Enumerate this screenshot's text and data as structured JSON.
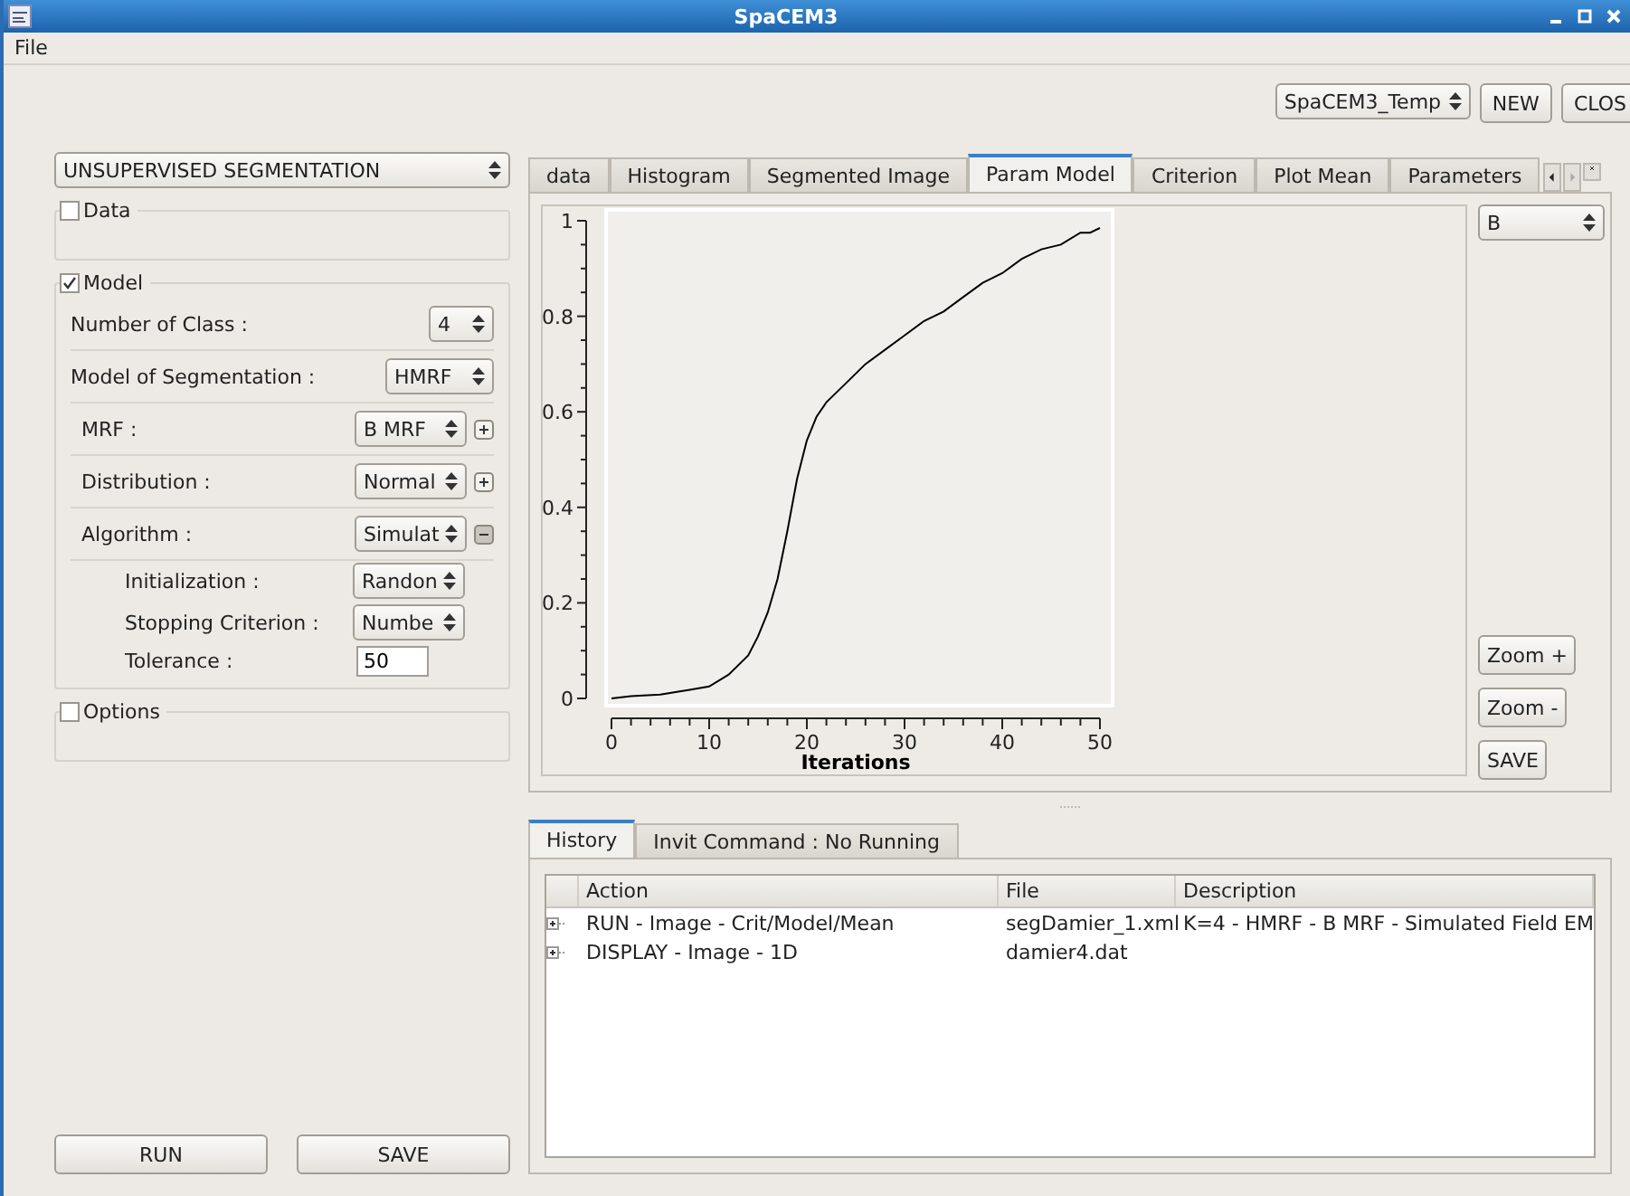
{
  "window": {
    "title": "SpaCEM3"
  },
  "menu": [
    "File"
  ],
  "project_bar": {
    "project": "SpaCEM3_Temp",
    "buttons": [
      "NEW",
      "CLOS"
    ]
  },
  "left_panel": {
    "mode": "UNSUPERVISED SEGMENTATION",
    "sections": [
      {
        "title": "Data",
        "checked": false
      },
      {
        "title": "Model",
        "checked": true,
        "rows": [
          {
            "kind": "spin",
            "label": "Number of Class :",
            "value": "4"
          },
          {
            "kind": "combo",
            "label": "Model of Segmentation :",
            "value": "HMRF",
            "children": [
              {
                "kind": "combo",
                "label": "MRF :",
                "value": "B MRF",
                "expanded": false
              },
              {
                "kind": "combo",
                "label": "Distribution :",
                "value": "Normal",
                "expanded": false
              },
              {
                "kind": "combo",
                "label": "Algorithm :",
                "value": "Simulat",
                "expanded": true,
                "children": [
                  {
                    "kind": "combo",
                    "label": "Initialization :",
                    "value": "Randon"
                  },
                  {
                    "kind": "combo",
                    "label": "Stopping Criterion :",
                    "value": "Numbe"
                  },
                  {
                    "kind": "input",
                    "label": "Tolerance :",
                    "value": "50"
                  }
                ]
              }
            ]
          }
        ]
      },
      {
        "title": "Options",
        "checked": false
      }
    ],
    "buttons": [
      "RUN",
      "SAVE"
    ]
  },
  "tabs": [
    {
      "label": "data",
      "selected": false
    },
    {
      "label": "Histogram",
      "selected": false
    },
    {
      "label": "Segmented Image",
      "selected": false
    },
    {
      "label": "Param Model",
      "selected": true
    },
    {
      "label": "Criterion",
      "selected": false
    },
    {
      "label": "Plot Mean",
      "selected": false
    },
    {
      "label": "Parameters",
      "selected": false
    }
  ],
  "chart_panel": {
    "chart_data": {
      "type": "line",
      "xlabel": "Iterations",
      "xlim": [
        0,
        50
      ],
      "ylim": [
        0,
        1
      ],
      "xticks": [
        0,
        10,
        20,
        30,
        40,
        50
      ],
      "yticks": [
        0,
        0.2,
        0.4,
        0.6,
        0.8,
        1
      ],
      "x": [
        0,
        2,
        5,
        8,
        10,
        12,
        14,
        15,
        16,
        17,
        18,
        19,
        20,
        21,
        22,
        24,
        26,
        28,
        30,
        32,
        34,
        36,
        38,
        40,
        42,
        44,
        46,
        48,
        49,
        50
      ],
      "series": [
        {
          "color": "#000000",
          "values": [
            0,
            0.005,
            0.008,
            0.018,
            0.025,
            0.05,
            0.09,
            0.13,
            0.18,
            0.25,
            0.35,
            0.46,
            0.54,
            0.59,
            0.62,
            0.66,
            0.7,
            0.73,
            0.76,
            0.79,
            0.81,
            0.84,
            0.87,
            0.89,
            0.92,
            0.94,
            0.95,
            0.975,
            0.975,
            0.985
          ]
        }
      ]
    },
    "parameter": "B",
    "buttons": [
      "Zoom +",
      "Zoom -",
      "SAVE"
    ]
  },
  "bottom_tabs": [
    {
      "label": "History",
      "selected": true
    },
    {
      "label": "Invit Command : No Running",
      "selected": false
    }
  ],
  "history": {
    "columns": [
      "Action",
      "File",
      "Description"
    ],
    "rows": [
      {
        "action": "RUN - Image - Crit/Model/Mean",
        "file": "segDamier_1.xml",
        "description": "K=4 - HMRF - B MRF - Simulated Field EM",
        "expanded": false
      },
      {
        "action": "DISPLAY - Image - 1D",
        "file": "damier4.dat",
        "expanded": false
      }
    ]
  }
}
